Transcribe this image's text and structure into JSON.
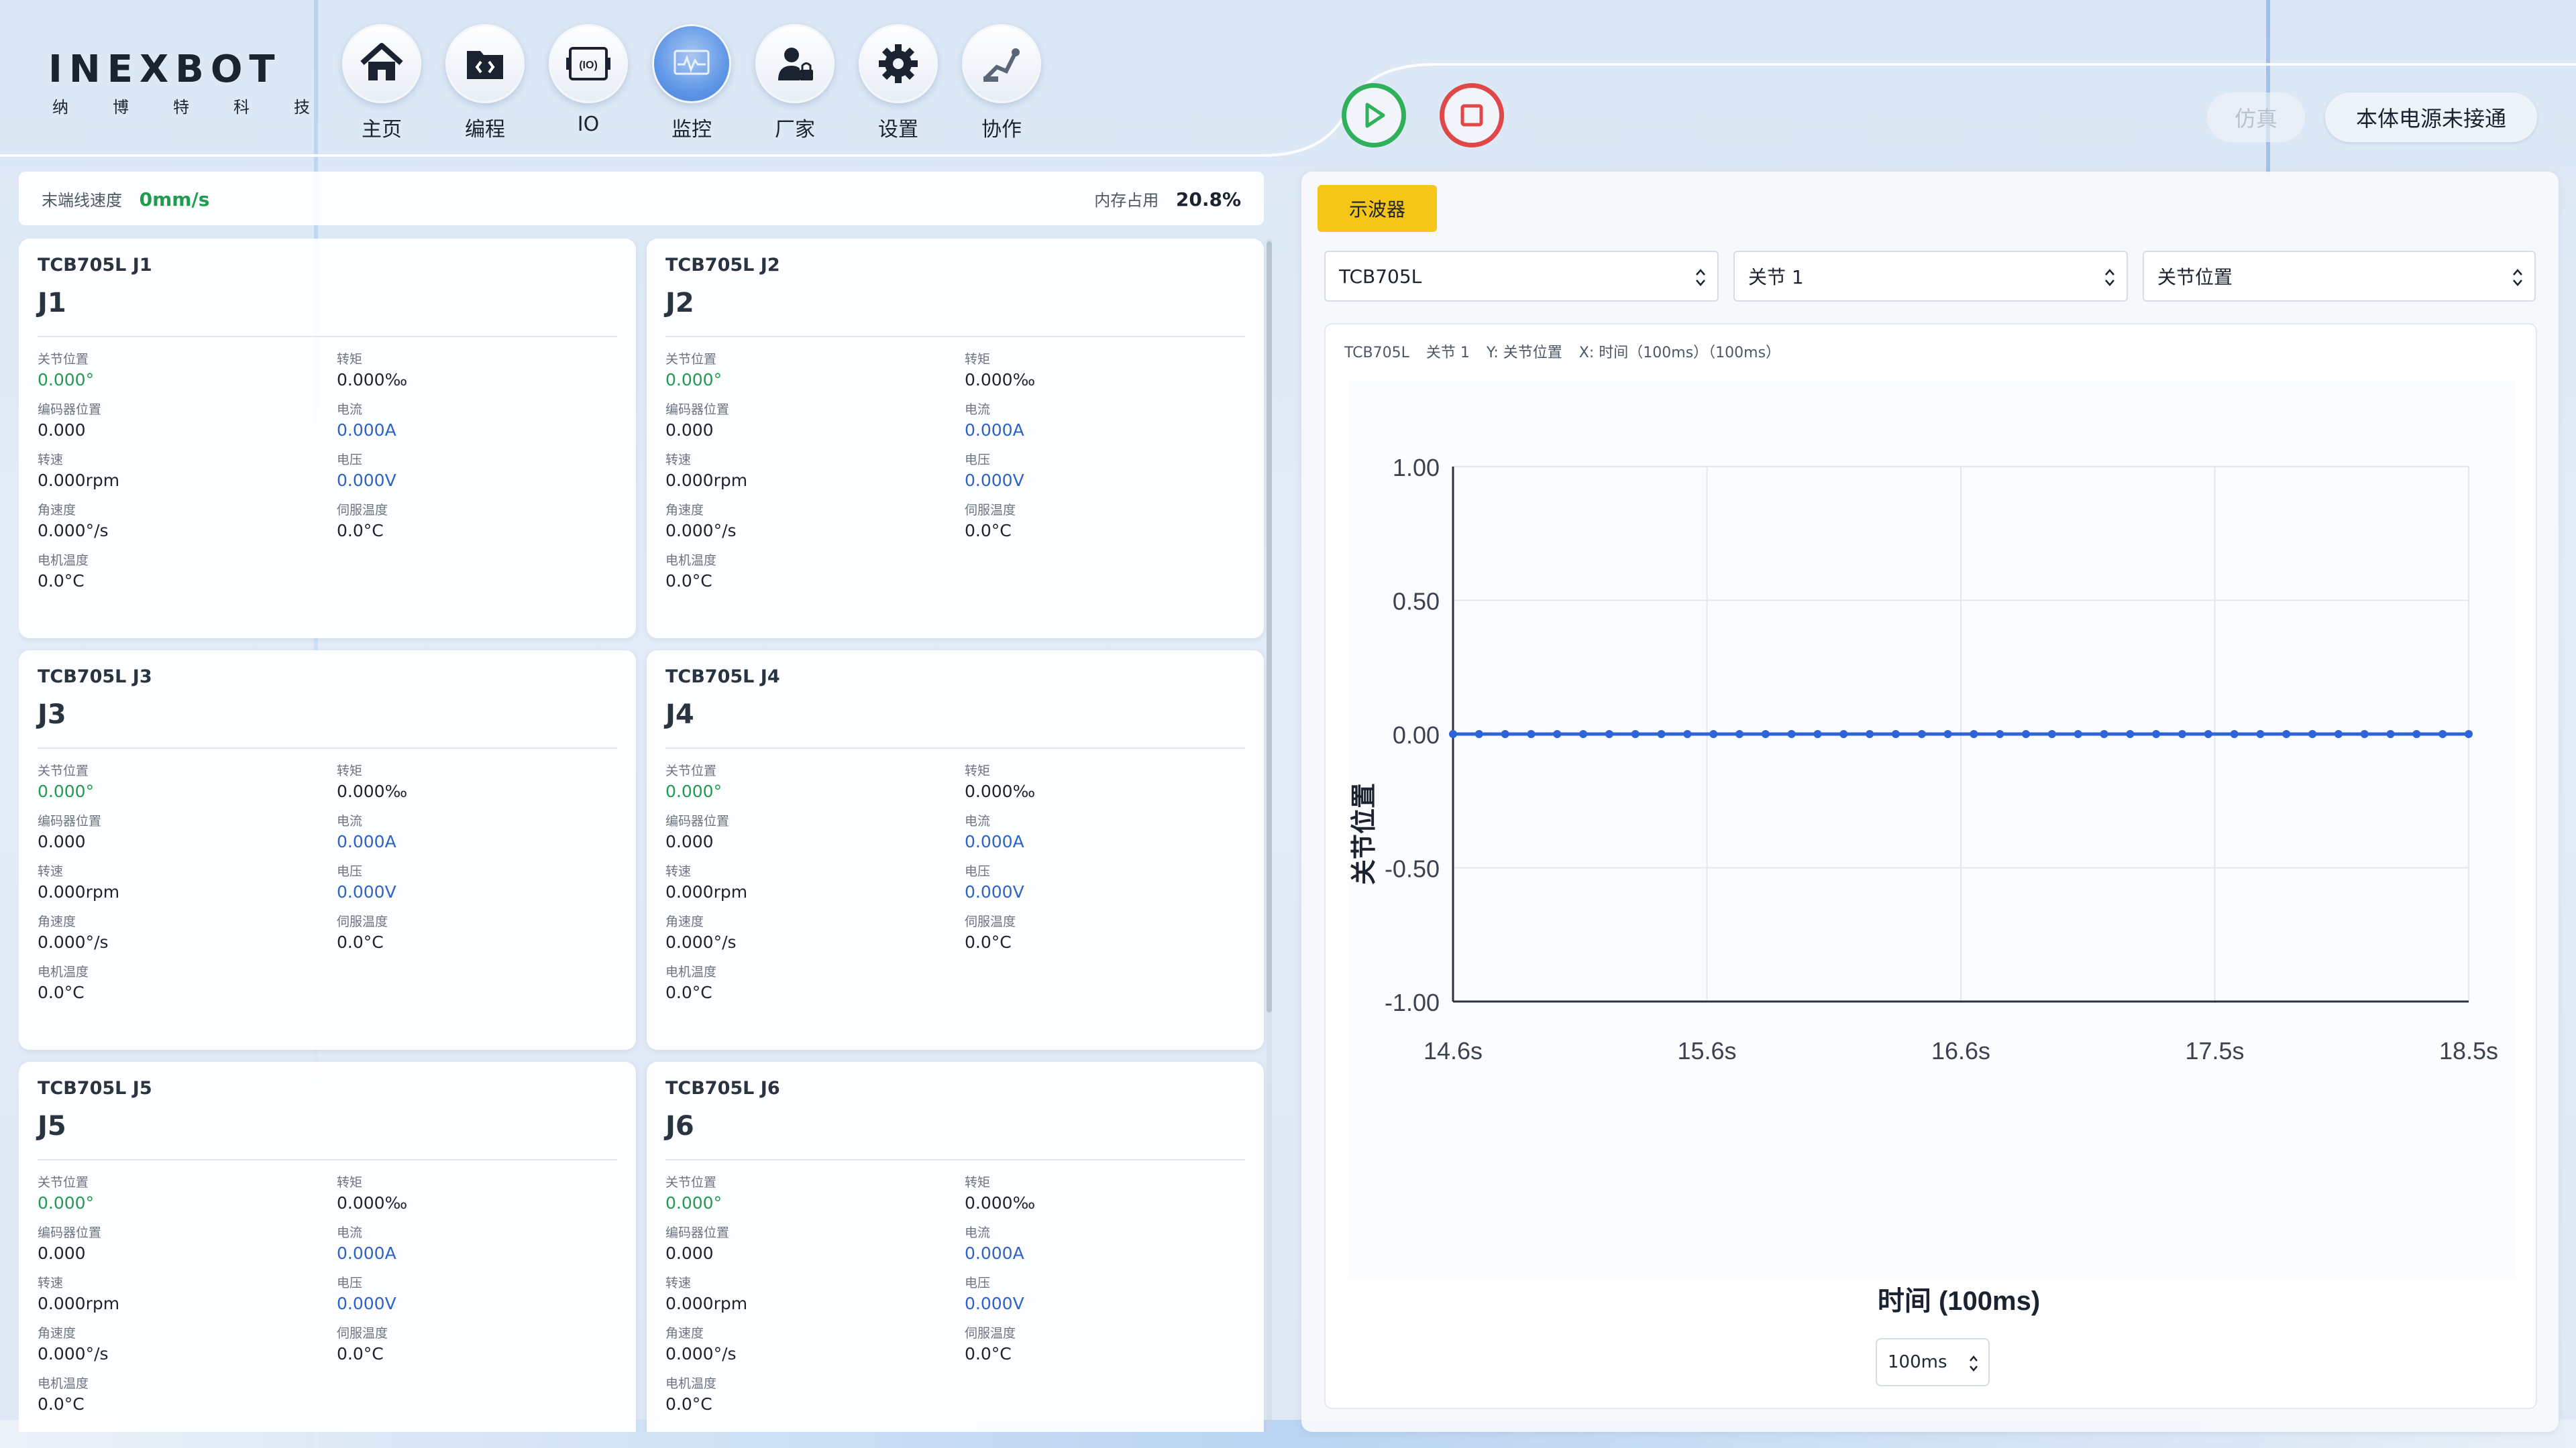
{
  "brand": {
    "name": "INEXBOT",
    "sub": [
      "纳",
      "博",
      "特",
      "科",
      "技"
    ]
  },
  "nav": [
    {
      "label": "主页",
      "icon": "home-icon"
    },
    {
      "label": "编程",
      "icon": "code-folder-icon"
    },
    {
      "label": "IO",
      "icon": "io-icon"
    },
    {
      "label": "监控",
      "icon": "monitor-icon"
    },
    {
      "label": "厂家",
      "icon": "manufacturer-lock-icon"
    },
    {
      "label": "设置",
      "icon": "gear-icon"
    },
    {
      "label": "协作",
      "icon": "collaboration-icon"
    }
  ],
  "header": {
    "sim_label": "仿真",
    "power_label": "本体电源未接通"
  },
  "stats": {
    "speed_label": "末端线速度",
    "speed_value": "0mm/s",
    "mem_label": "内存占用",
    "mem_value": "20.8%"
  },
  "joints": [
    {
      "sub": "TCB705L J1",
      "title": "J1"
    },
    {
      "sub": "TCB705L J2",
      "title": "J2"
    },
    {
      "sub": "TCB705L J3",
      "title": "J3"
    },
    {
      "sub": "TCB705L J4",
      "title": "J4"
    },
    {
      "sub": "TCB705L J5",
      "title": "J5"
    },
    {
      "sub": "TCB705L J6",
      "title": "J6"
    }
  ],
  "joint_fields": {
    "pos_label": "关节位置",
    "pos_value": "0.000°",
    "torque_label": "转矩",
    "torque_value": "0.000‰",
    "enc_label": "编码器位置",
    "enc_value": "0.000",
    "current_label": "电流",
    "current_value": "0.000A",
    "rpm_label": "转速",
    "rpm_value": "0.000rpm",
    "voltage_label": "电压",
    "voltage_value": "0.000V",
    "angvel_label": "角速度",
    "angvel_value": "0.000°/s",
    "servo_temp_label": "伺服温度",
    "servo_temp_value": "0.0°C",
    "motor_temp_label": "电机温度",
    "motor_temp_value": "0.0°C"
  },
  "oscilloscope": {
    "tag": "示波器",
    "select_robot": "TCB705L",
    "select_joint": "关节 1",
    "select_metric": "关节位置",
    "head": [
      "TCB705L",
      "关节 1",
      "Y: 关节位置",
      "X: 时间（100ms）（100ms）"
    ],
    "interval": "100ms"
  },
  "chart_data": {
    "type": "line",
    "title": "",
    "xlabel": "时间 (100ms)",
    "ylabel": "关节位置",
    "ylim": [
      -1.0,
      1.0
    ],
    "yticks": [
      "1.00",
      "0.50",
      "0.00",
      "-0.50",
      "-1.00"
    ],
    "xticks": [
      "14.6s",
      "15.6s",
      "16.6s",
      "17.5s",
      "18.5s"
    ],
    "grid": true,
    "color": "#2f63d8",
    "series": [
      {
        "values": [
          0,
          0,
          0,
          0,
          0,
          0,
          0,
          0,
          0,
          0,
          0,
          0,
          0,
          0,
          0,
          0,
          0,
          0,
          0,
          0,
          0,
          0,
          0,
          0,
          0,
          0,
          0,
          0,
          0,
          0,
          0,
          0,
          0,
          0,
          0,
          0,
          0,
          0,
          0,
          0
        ]
      }
    ]
  }
}
